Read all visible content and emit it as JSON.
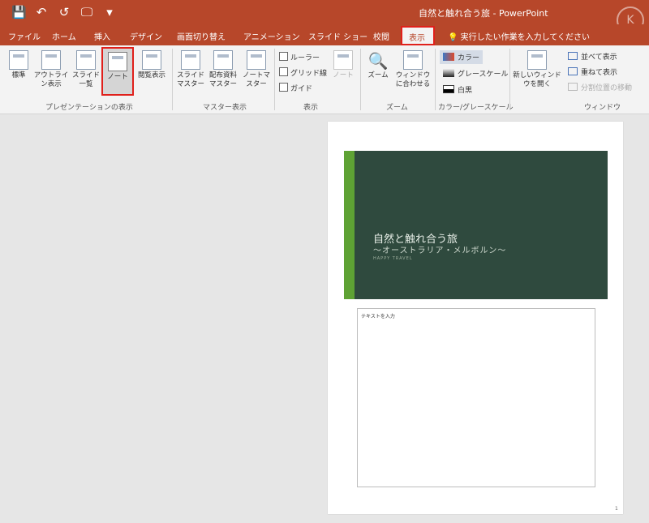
{
  "window": {
    "title": "自然と触れ合う旅 - PowerPoint"
  },
  "qat": {
    "save": "💾",
    "undo": "↶",
    "redo": "↺",
    "start": "🖵",
    "more": "▾"
  },
  "tabs": [
    "ファイル",
    "ホーム",
    "挿入",
    "デザイン",
    "画面切り替え",
    "アニメーション",
    "スライド ショー",
    "校閲",
    "表示"
  ],
  "tell_me": "実行したい作業を入力してください",
  "ribbon": {
    "presentation_views": {
      "label": "プレゼンテーションの表示",
      "buttons": [
        "標準",
        "アウトライン表示",
        "スライド一覧",
        "ノート",
        "閲覧表示"
      ]
    },
    "master_views": {
      "label": "マスター表示",
      "buttons": [
        "スライドマスター",
        "配布資料マスター",
        "ノートマスター"
      ]
    },
    "show": {
      "label": "表示",
      "checkboxes": [
        "ルーラー",
        "グリッド線",
        "ガイド"
      ],
      "notes": "ノート"
    },
    "zoom": {
      "label": "ズーム",
      "buttons": [
        "ズーム",
        "ウィンドウに合わせる"
      ]
    },
    "color": {
      "label": "カラー/グレースケール",
      "options": [
        "カラー",
        "グレースケール",
        "白黒"
      ]
    },
    "window": {
      "label": "ウィンドウ",
      "new_window": "新しいウィンドウを開く",
      "items": [
        "並べて表示",
        "重ねて表示",
        "分割位置の移動"
      ]
    }
  },
  "slide": {
    "title": "自然と触れ合う旅",
    "subtitle": "～オーストラリア・メルボルン～",
    "footer": "HAPPY TRAVEL"
  },
  "notes_placeholder": "テキストを入力",
  "page_number": "1",
  "colors": {
    "accent": "#b7472a",
    "slide_bg": "#2f4a3e",
    "slide_bar": "#5ea234"
  }
}
